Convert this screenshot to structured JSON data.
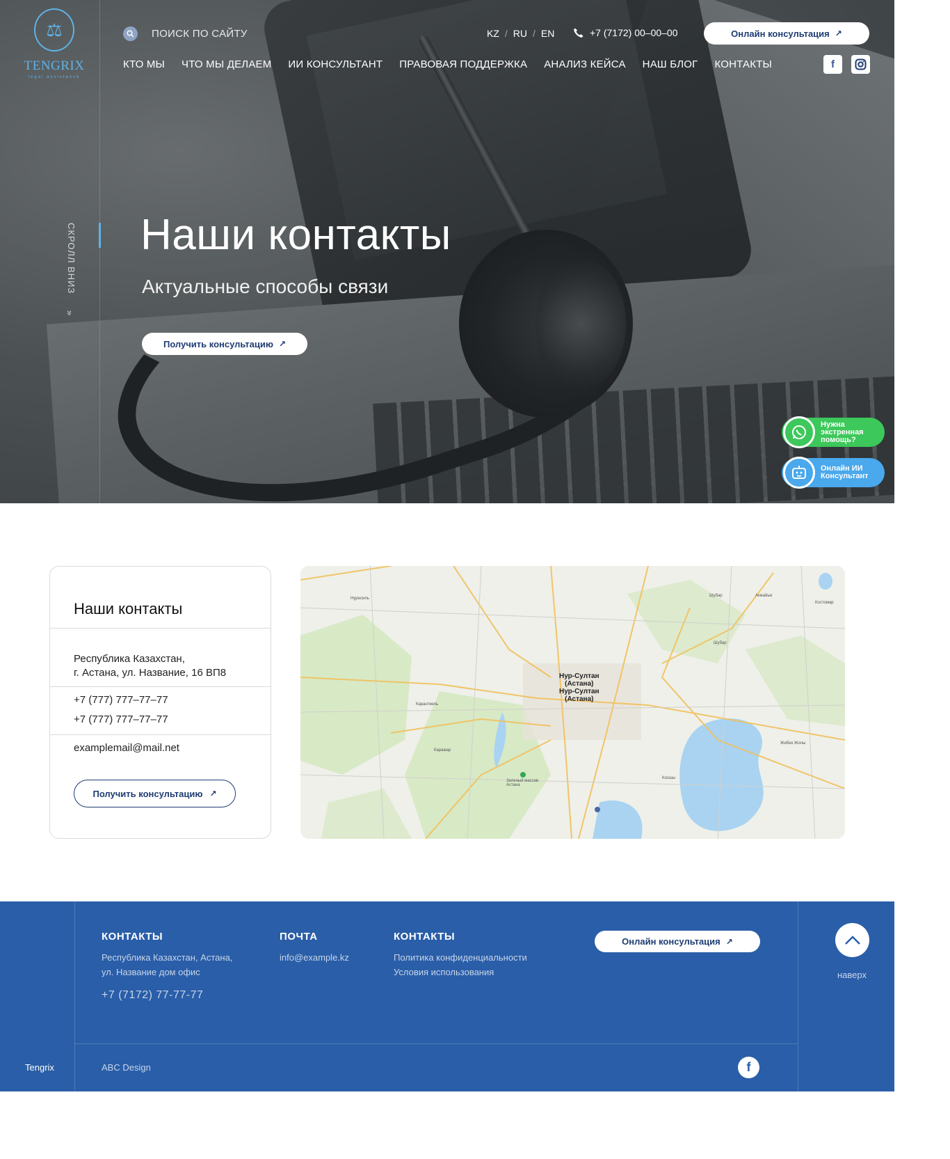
{
  "brand": {
    "name": "TENGRIX",
    "tagline": "legal assistance",
    "accent": "#5fb3e6"
  },
  "header": {
    "search_label": "ПОИСК ПО САЙТУ",
    "langs": [
      "KZ",
      "RU",
      "EN"
    ],
    "phone": "+7 (7172) 00–00–00",
    "online_btn": "Онлайн консультация",
    "nav": [
      "КТО МЫ",
      "ЧТО МЫ ДЕЛАЕМ",
      "ИИ КОНСУЛЬТАНТ",
      "ПРАВОВАЯ ПОДДЕРЖКА",
      "АНАЛИЗ КЕЙСА",
      "НАШ БЛОГ",
      "КОНТАКТЫ"
    ],
    "social_icons": [
      "facebook-icon",
      "instagram-icon"
    ]
  },
  "hero": {
    "scroll_label": "СКРОЛЛ ВНИЗ",
    "title": "Наши контакты",
    "subtitle": "Актуальные способы связи",
    "cta": "Получить консультацию"
  },
  "floating": {
    "whatsapp": "Нужна экстренная помощь?",
    "ai": "Онлайн ИИ Консультант"
  },
  "contacts_card": {
    "title": "Наши контакты",
    "address_line1": "Республика Казахстан,",
    "address_line2": "г. Астана, ул. Название, 16 ВП8",
    "phone1": "+7 (777) 777–77–77",
    "phone2": "+7 (777) 777–77–77",
    "email": "examplemail@mail.net",
    "cta": "Получить консультацию"
  },
  "map": {
    "city_labels": [
      "Нур-Султан",
      "(Астана)",
      "Нур-Султан",
      "(Астана)"
    ],
    "small_labels": [
      "Нуресиль",
      "Караоткель",
      "Каражар",
      "Шубар",
      "Акжайык",
      "Костомар",
      "Шубар",
      "Жибек Жолы",
      "Косшы",
      "Зеленый массив Астана"
    ]
  },
  "footer": {
    "col1_head": "КОНТАКТЫ",
    "col1_addr1": "Республика Казахстан, Астана,",
    "col1_addr2": "ул. Название дом офис",
    "col1_phone": "+7 (7172) 77-77-77",
    "col2_head": "ПОЧТА",
    "col2_email": "info@example.kz",
    "col3_head": "КОНТАКТЫ",
    "col3_link1": "Политика конфиденциальности",
    "col3_link2": "Условия использования",
    "online_btn": "Онлайн консультация",
    "up_label": "наверх",
    "brand": "Tengrix",
    "design": "ABC Design",
    "bg_color": "#2a5ea8"
  }
}
